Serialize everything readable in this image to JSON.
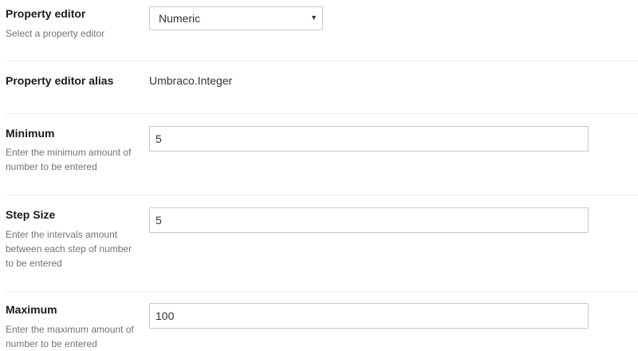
{
  "property_editor": {
    "label": "Property editor",
    "description": "Select a property editor",
    "selected": "Numeric"
  },
  "property_editor_alias": {
    "label": "Property editor alias",
    "value": "Umbraco.Integer"
  },
  "minimum": {
    "label": "Minimum",
    "description": "Enter the minimum amount of number to be entered",
    "value": "5"
  },
  "step_size": {
    "label": "Step Size",
    "description": "Enter the intervals amount between each step of number to be entered",
    "value": "5"
  },
  "maximum": {
    "label": "Maximum",
    "description": "Enter the maximum amount of number to be entered",
    "value": "100"
  },
  "icons": {
    "select_caret": "caret-down-icon"
  }
}
